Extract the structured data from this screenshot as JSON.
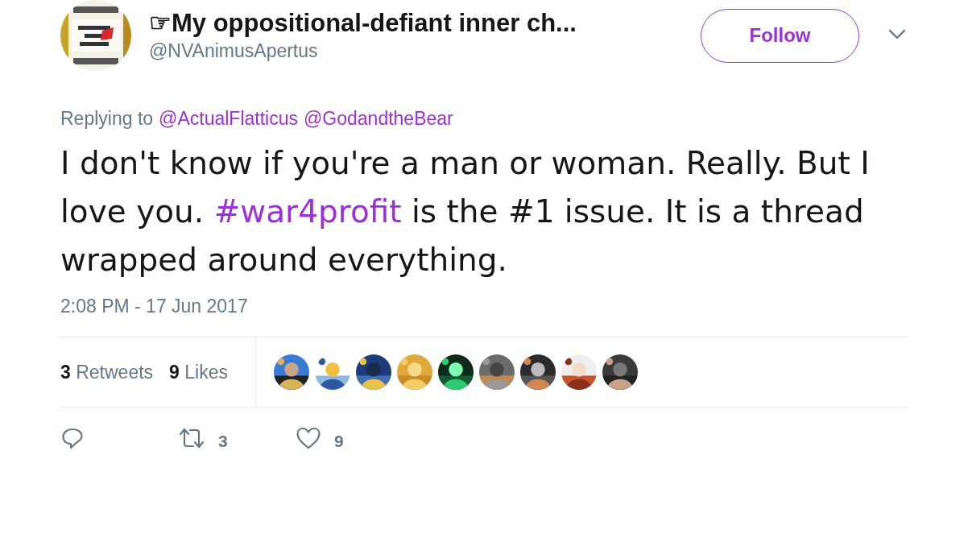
{
  "author": {
    "display_name": "☞My oppositional-defiant inner ch...",
    "handle": "@NVAnimusApertus"
  },
  "follow_button": {
    "label": "Follow"
  },
  "reply_context": {
    "prefix": "Replying to",
    "mentions": [
      "@ActualFlatticus",
      "@GodandtheBear"
    ]
  },
  "tweet": {
    "parts": [
      {
        "kind": "text",
        "text": "I don't know if you're a man or woman. Really. But I love you. "
      },
      {
        "kind": "hashtag",
        "text": "#war4profit"
      },
      {
        "kind": "text",
        "text": " is the #1 issue. It is a thread wrapped around everything."
      }
    ]
  },
  "timestamp": "2:08 PM - 17 Jun 2017",
  "stats": [
    {
      "count": "3",
      "label": "Retweets"
    },
    {
      "count": "9",
      "label": "Likes"
    }
  ],
  "actions": [
    {
      "kind": "reply"
    },
    {
      "kind": "retweet",
      "count": "3"
    },
    {
      "kind": "like",
      "count": "9"
    }
  ]
}
